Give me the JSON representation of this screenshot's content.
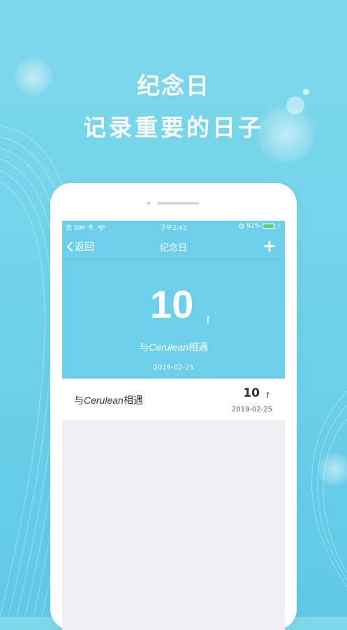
{
  "promo": {
    "headline": "纪念日",
    "subheadline": "记录重要的日子"
  },
  "status_bar": {
    "carrier": "无 SIM 卡",
    "time": "下午2:42",
    "battery": "92%",
    "battery_level": 0.92,
    "battery_color": "#4cd964"
  },
  "nav": {
    "back_label": "返回",
    "title": "纪念日",
    "add_label": "+"
  },
  "hero": {
    "days": "10",
    "arrow": "↾",
    "title_prefix": "与",
    "title_name": "Cerulean",
    "title_suffix": "相遇",
    "date": "2019-02-25"
  },
  "events": [
    {
      "title_prefix": "与",
      "title_name": "Cerulean",
      "title_suffix": "相遇",
      "days": "10",
      "arrow": "↾",
      "date": "2019-02-25"
    }
  ],
  "colors": {
    "background": "#6fd2ea",
    "accent": "#6dcfe9",
    "list_bg": "#efeff4"
  }
}
